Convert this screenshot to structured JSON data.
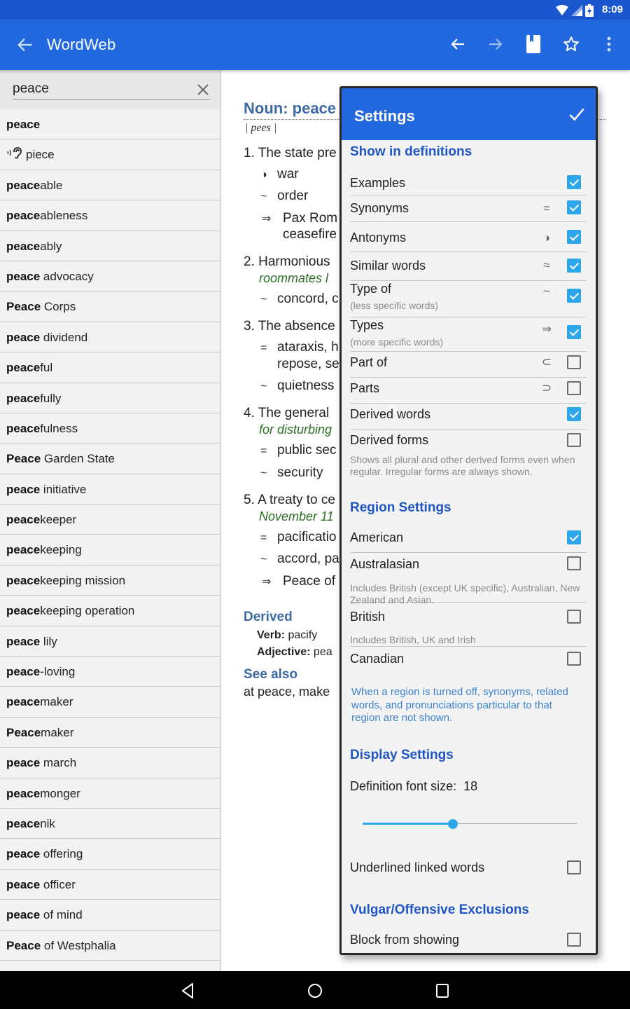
{
  "status_bar": {
    "time": "8:09",
    "icons": [
      "wifi-icon",
      "signal-icon",
      "battery-charging-icon"
    ]
  },
  "app_bar": {
    "title": "WordWeb",
    "actions": [
      "back-arrow",
      "history-back",
      "history-forward",
      "bookmark",
      "favorite-star",
      "overflow-menu"
    ]
  },
  "search": {
    "value": "peace",
    "placeholder": ""
  },
  "word_list": [
    {
      "bold": "peace",
      "rest": ""
    },
    {
      "bold": "",
      "rest": "piece",
      "sound_alike": true
    },
    {
      "bold": "peace",
      "rest": "able"
    },
    {
      "bold": "peace",
      "rest": "ableness"
    },
    {
      "bold": "peace",
      "rest": "ably"
    },
    {
      "bold": "peace",
      "rest": " advocacy"
    },
    {
      "bold": "Peace",
      "rest": " Corps"
    },
    {
      "bold": "peace",
      "rest": " dividend"
    },
    {
      "bold": "peace",
      "rest": "ful"
    },
    {
      "bold": "peace",
      "rest": "fully"
    },
    {
      "bold": "peace",
      "rest": "fulness"
    },
    {
      "bold": "Peace",
      "rest": " Garden State"
    },
    {
      "bold": "peace",
      "rest": " initiative"
    },
    {
      "bold": "peace",
      "rest": "keeper"
    },
    {
      "bold": "peace",
      "rest": "keeping"
    },
    {
      "bold": "peace",
      "rest": "keeping mission"
    },
    {
      "bold": "peace",
      "rest": "keeping operation"
    },
    {
      "bold": "peace",
      "rest": " lily"
    },
    {
      "bold": "peace",
      "rest": "-loving"
    },
    {
      "bold": "peace",
      "rest": "maker"
    },
    {
      "bold": "Peace",
      "rest": "maker"
    },
    {
      "bold": "peace",
      "rest": " march"
    },
    {
      "bold": "peace",
      "rest": "monger"
    },
    {
      "bold": "peace",
      "rest": "nik"
    },
    {
      "bold": "peace",
      "rest": " offering"
    },
    {
      "bold": "peace",
      "rest": " officer"
    },
    {
      "bold": "peace",
      "rest": " of mind"
    },
    {
      "bold": "Peace",
      "rest": " of Westphalia"
    }
  ],
  "definition": {
    "heading": "Noun: peace",
    "pronunciation": "| pees |",
    "senses": {
      "s1": "1. The state pre",
      "s1_ant": "war",
      "s1_sim": "order",
      "s1_types_a": "Pax Rom",
      "s1_types_b": "ceasefire",
      "s2": "2. Harmonious",
      "s2_ex": "roommates l",
      "s2_sim": "concord, c",
      "s3": "3. The absence",
      "s3_syn_a": "ataraxis, h",
      "s3_syn_b": "repose, se",
      "s3_sim": "quietness",
      "s4": "4. The general",
      "s4_ex": "for disturbing",
      "s4_syn": "public sec",
      "s4_sim": "security",
      "s5": "5. A treaty to ce",
      "s5_ex": "November 11",
      "s5_syn": "pacificatio",
      "s5_sim": "accord, pa",
      "s5_types": "Peace of"
    },
    "symbols": {
      "antonym": "◑",
      "similar": "~",
      "types": "⇒",
      "synonym": "="
    },
    "derived_label": "Derived",
    "derived_verb_label": "Verb:",
    "derived_verb": " pacify",
    "derived_adj_label": "Adjective:",
    "derived_adj": " pea",
    "see_also_label": "See also",
    "see_also": "at peace, make"
  },
  "settings": {
    "title": "Settings",
    "sections": {
      "show": "Show in definitions",
      "region": "Region Settings",
      "display": "Display Settings",
      "vulgar": "Vulgar/Offensive Exclusions"
    },
    "show_items": [
      {
        "label": "Examples",
        "glyph": "",
        "checked": true
      },
      {
        "label": "Synonyms",
        "glyph": "=",
        "checked": true
      },
      {
        "label": "Antonyms",
        "glyph": "◑",
        "checked": true
      },
      {
        "label": "Similar words",
        "glyph": "≈",
        "checked": true
      },
      {
        "label": "Type of",
        "sub": "(less specific words)",
        "glyph": "~",
        "checked": true
      },
      {
        "label": "Types",
        "sub": "(more specific words)",
        "glyph": "⇒",
        "checked": true
      },
      {
        "label": "Part of",
        "glyph": "⊂",
        "checked": false
      },
      {
        "label": "Parts",
        "glyph": "⊃",
        "checked": false
      },
      {
        "label": "Derived words",
        "glyph": "",
        "checked": true
      },
      {
        "label": "Derived forms",
        "glyph": "",
        "checked": false
      }
    ],
    "derived_forms_note": "Shows all plural and other derived forms even when regular. Irregular forms are always shown.",
    "regions": [
      {
        "label": "American",
        "checked": true
      },
      {
        "label": "Australasian",
        "checked": false,
        "note": "Includes British (except UK specific), Australian, New Zealand and Asian."
      },
      {
        "label": "British",
        "checked": false,
        "note": "Includes British, UK and Irish"
      },
      {
        "label": "Canadian",
        "checked": false
      }
    ],
    "region_note": "When a region is turned off, synonyms, related words, and pronunciations particular to that region are not shown.",
    "font_size_label": "Definition font size:",
    "font_size_value": "18",
    "font_size_slider_fraction": 0.42,
    "underlined_label": "Underlined linked words",
    "underlined_checked": false,
    "block_label": "Block from showing",
    "block_checked": false
  },
  "nav_bar": {
    "buttons": [
      "back",
      "home",
      "recents"
    ]
  }
}
